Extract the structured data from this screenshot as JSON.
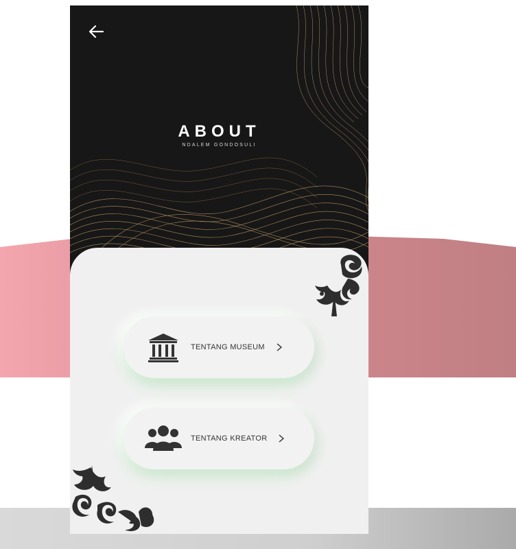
{
  "header": {
    "back_icon": "arrow-left-icon",
    "title": "ABOUT",
    "subtitle": "NDALEM GONDOSULI"
  },
  "menu": [
    {
      "label": "TENTANG MUSEUM",
      "icon": "museum-icon"
    },
    {
      "label": "TENTANG KREATOR",
      "icon": "people-group-icon"
    }
  ],
  "colors": {
    "hero_bg": "#171717",
    "panel_bg": "#f0f0f0",
    "wave_gold": "#c9a26a",
    "button_glow": "#b4ebb9",
    "icon_dark": "#333333"
  }
}
